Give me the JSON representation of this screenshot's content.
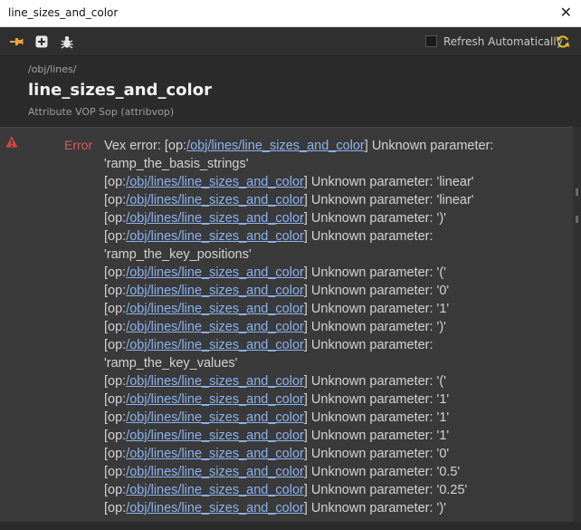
{
  "window": {
    "title": "line_sizes_and_color",
    "close_glyph": "✕"
  },
  "toolbar": {
    "refresh_label": "Refresh Automatically",
    "refresh_checked": false,
    "icons": [
      "pin-icon",
      "add-icon",
      "bug-icon",
      "refresh-icon"
    ]
  },
  "node": {
    "path": "/obj/lines/",
    "name": "line_sizes_and_color",
    "type_label": "Attribute VOP Sop (attribvop)"
  },
  "error": {
    "severity": "Error",
    "lines": [
      {
        "pre": "Vex error: [op:",
        "link": "/obj/lines/line_sizes_and_color",
        "post": "] Unknown parameter:"
      },
      {
        "pre": "'ramp_the_basis_strings'"
      },
      {
        "pre": "[op:",
        "link": "/obj/lines/line_sizes_and_color",
        "post": "] Unknown parameter: 'linear'"
      },
      {
        "pre": "[op:",
        "link": "/obj/lines/line_sizes_and_color",
        "post": "] Unknown parameter: 'linear'"
      },
      {
        "pre": "[op:",
        "link": "/obj/lines/line_sizes_and_color",
        "post": "] Unknown parameter: ')'"
      },
      {
        "pre": "[op:",
        "link": "/obj/lines/line_sizes_and_color",
        "post": "] Unknown parameter:"
      },
      {
        "pre": "'ramp_the_key_positions'"
      },
      {
        "pre": "[op:",
        "link": "/obj/lines/line_sizes_and_color",
        "post": "] Unknown parameter: '('"
      },
      {
        "pre": "[op:",
        "link": "/obj/lines/line_sizes_and_color",
        "post": "] Unknown parameter: '0'"
      },
      {
        "pre": "[op:",
        "link": "/obj/lines/line_sizes_and_color",
        "post": "] Unknown parameter: '1'"
      },
      {
        "pre": "[op:",
        "link": "/obj/lines/line_sizes_and_color",
        "post": "] Unknown parameter: ')'"
      },
      {
        "pre": "[op:",
        "link": "/obj/lines/line_sizes_and_color",
        "post": "] Unknown parameter:"
      },
      {
        "pre": "'ramp_the_key_values'"
      },
      {
        "pre": "[op:",
        "link": "/obj/lines/line_sizes_and_color",
        "post": "] Unknown parameter: '('"
      },
      {
        "pre": "[op:",
        "link": "/obj/lines/line_sizes_and_color",
        "post": "] Unknown parameter: '1'"
      },
      {
        "pre": "[op:",
        "link": "/obj/lines/line_sizes_and_color",
        "post": "] Unknown parameter: '1'"
      },
      {
        "pre": "[op:",
        "link": "/obj/lines/line_sizes_and_color",
        "post": "] Unknown parameter: '1'"
      },
      {
        "pre": "[op:",
        "link": "/obj/lines/line_sizes_and_color",
        "post": "] Unknown parameter: '0'"
      },
      {
        "pre": "[op:",
        "link": "/obj/lines/line_sizes_and_color",
        "post": "] Unknown parameter: '0.5'"
      },
      {
        "pre": "[op:",
        "link": "/obj/lines/line_sizes_and_color",
        "post": "] Unknown parameter: '0.25'"
      },
      {
        "pre": "[op:",
        "link": "/obj/lines/line_sizes_and_color",
        "post": "] Unknown parameter: ')'"
      }
    ]
  },
  "colors": {
    "error_red": "#d95a5a",
    "link_blue": "#8cb3ee",
    "refresh_yellow": "#e8c020",
    "pin_orange": "#e8a33a"
  }
}
